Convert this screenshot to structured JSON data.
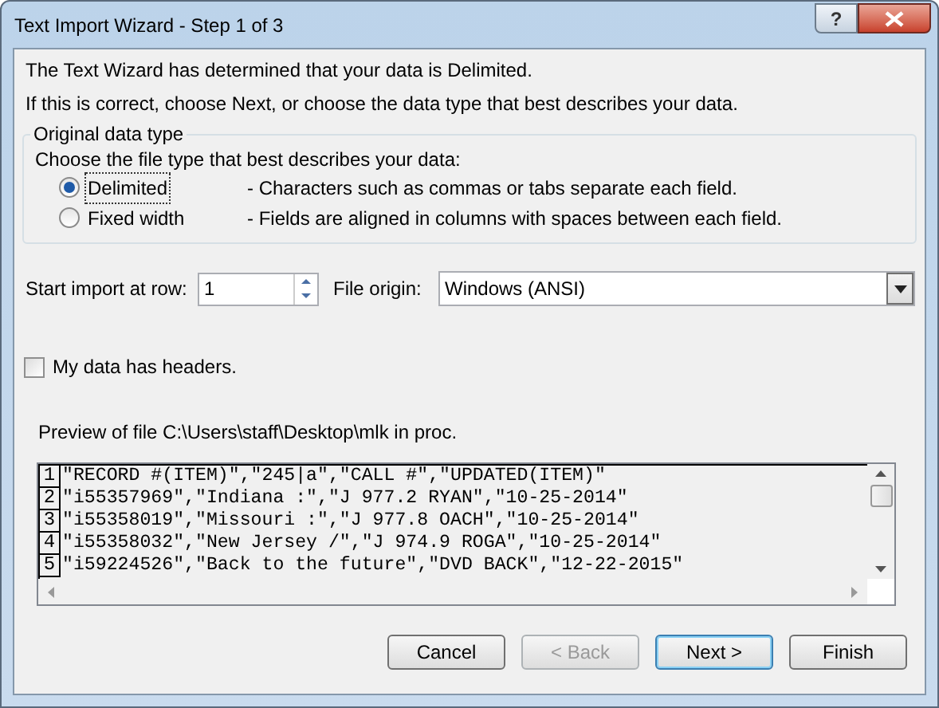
{
  "window": {
    "title": "Text Import Wizard - Step 1 of 3",
    "help_button": "?"
  },
  "intro": [
    "The Text Wizard has determined that your data is Delimited.",
    "If this is correct, choose Next, or choose the data type that best describes your data."
  ],
  "data_type_group": {
    "title": "Original data type",
    "prompt": "Choose the file type that best describes your data:",
    "options": [
      {
        "label": "Delimited",
        "description": "- Characters such as commas or tabs separate each field.",
        "selected": true
      },
      {
        "label": "Fixed width",
        "description": "- Fields are aligned in columns with spaces between each field.",
        "selected": false
      }
    ]
  },
  "start_row": {
    "label": "Start import at row:",
    "value": "1"
  },
  "file_origin": {
    "label": "File origin:",
    "value": "Windows (ANSI)"
  },
  "headers_checkbox": {
    "label": "My data has headers.",
    "checked": false
  },
  "preview": {
    "title": "Preview of file C:\\Users\\staff\\Desktop\\mlk in proc.",
    "lines": [
      {
        "number": "1",
        "text": "\"RECORD #(ITEM)\",\"245|a\",\"CALL #\",\"UPDATED(ITEM)\""
      },
      {
        "number": "2",
        "text": "\"i55357969\",\"Indiana :\",\"J 977.2 RYAN\",\"10-25-2014\""
      },
      {
        "number": "3",
        "text": "\"i55358019\",\"Missouri :\",\"J 977.8 OACH\",\"10-25-2014\""
      },
      {
        "number": "4",
        "text": "\"i55358032\",\"New Jersey /\",\"J 974.9 ROGA\",\"10-25-2014\""
      },
      {
        "number": "5",
        "text": "\"i59224526\",\"Back to the future\",\"DVD BACK\",\"12-22-2015\""
      }
    ]
  },
  "buttons": [
    {
      "label": "Cancel",
      "disabled": false,
      "default": false
    },
    {
      "label": "< Back",
      "disabled": true,
      "default": false
    },
    {
      "label": "Next >",
      "disabled": false,
      "default": true
    },
    {
      "label": "Finish",
      "disabled": false,
      "default": false
    }
  ]
}
